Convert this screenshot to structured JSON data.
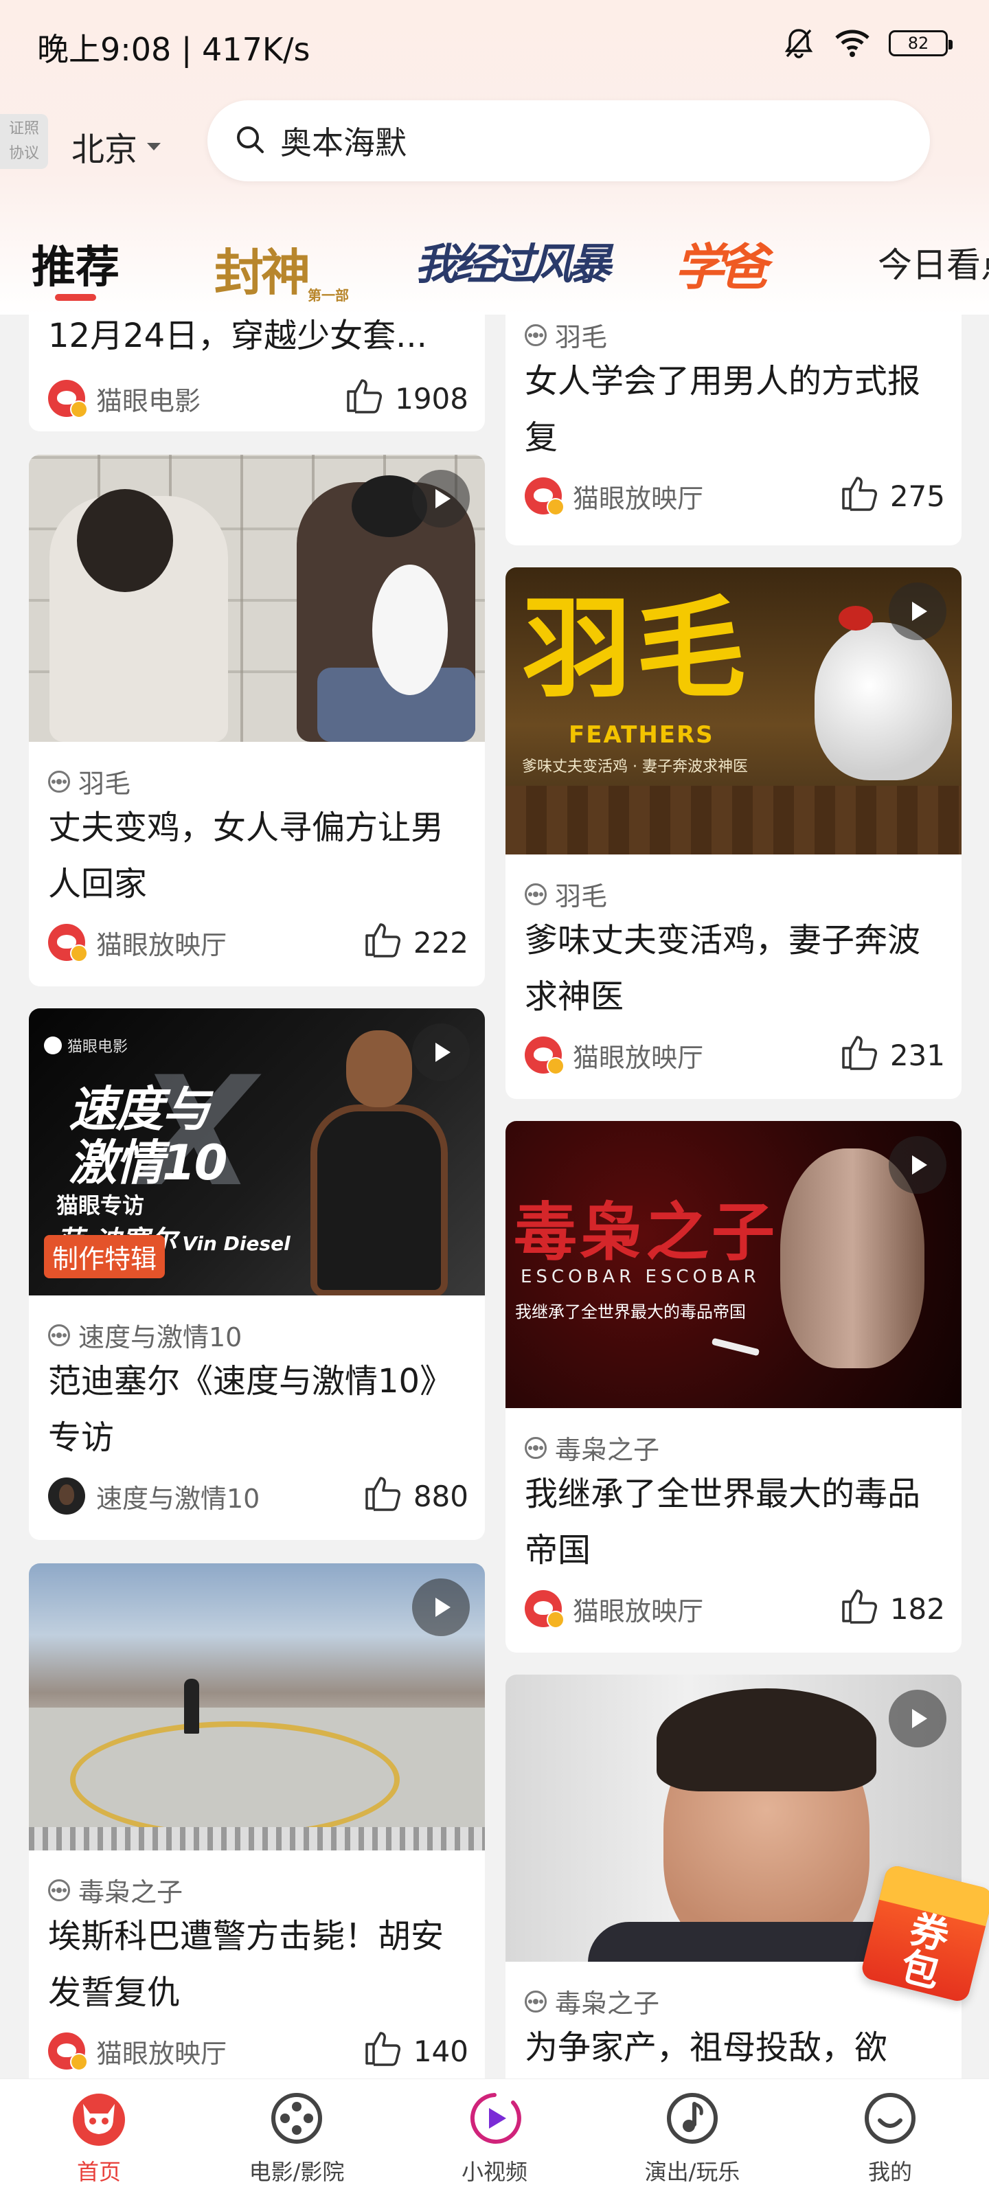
{
  "status_bar": {
    "time": "晚上9:08 | 417K/s",
    "battery": "82",
    "icons": [
      "bell-off-icon",
      "wifi-icon",
      "battery-icon"
    ]
  },
  "header": {
    "cert_badge": [
      "证照",
      "协议"
    ],
    "city": "北京",
    "search_text": "奥本海默"
  },
  "tabs": {
    "recommend": "推荐",
    "fengshen": "封神",
    "fengshen_sub": "第一部",
    "fengbao": "我经过风暴",
    "xueba": "学爸",
    "today": "今日看点"
  },
  "feed": {
    "left": [
      {
        "title": "12月24日，穿越少女套...",
        "author": "猫眼电影",
        "likes": "1908"
      },
      {
        "tag": "羽毛",
        "title": "丈夫变鸡，女人寻偏方让男人回家",
        "author": "猫眼放映厅",
        "likes": "222"
      },
      {
        "img_logo": "猫眼电影",
        "img_title_line1": "速度与",
        "img_title_line2": "激情10",
        "img_interview": "猫眼专访",
        "img_name": "范·迪塞尔",
        "img_name_en": "Vin Diesel",
        "badge": "制作特辑",
        "tag": "速度与激情10",
        "title": "范迪塞尔《速度与激情10》专访",
        "author": "速度与激情10",
        "likes": "880"
      },
      {
        "tag": "毒枭之子",
        "title": "埃斯科巴遭警方击毙！胡安发誓复仇",
        "author": "猫眼放映厅",
        "likes": "140"
      }
    ],
    "right": [
      {
        "tag": "羽毛",
        "title": "女人学会了用男人的方式报复",
        "author": "猫眼放映厅",
        "likes": "275"
      },
      {
        "img_title": "羽毛",
        "img_title_en": "FEATHERS",
        "img_sub": "爹味丈夫变活鸡 · 妻子奔波求神医",
        "tag": "羽毛",
        "title": "爹味丈夫变活鸡，妻子奔波求神医",
        "author": "猫眼放映厅",
        "likes": "231"
      },
      {
        "img_title": "毒枭之子",
        "img_en": "ESCOBAR  ESCOBAR",
        "img_sub": "我继承了全世界最大的毒品帝国",
        "tag": "毒枭之子",
        "title": "我继承了全世界最大的毒品帝国",
        "author": "猫眼放映厅",
        "likes": "182"
      },
      {
        "tag": "毒枭之子",
        "title": "为争家产，祖母投敌，欲"
      }
    ]
  },
  "coupon": "券包",
  "bottom_nav": [
    {
      "label": "首页",
      "icon": "cat-home-icon",
      "active": true
    },
    {
      "label": "电影/影院",
      "icon": "film-reel-icon",
      "active": false
    },
    {
      "label": "小视频",
      "icon": "video-play-icon",
      "active": false
    },
    {
      "label": "演出/玩乐",
      "icon": "music-note-icon",
      "active": false
    },
    {
      "label": "我的",
      "icon": "profile-smile-icon",
      "active": false
    }
  ],
  "colors": {
    "accent": "#e8403b",
    "header_bg": "#fdeee8",
    "feed_bg": "#f2f2f2"
  }
}
